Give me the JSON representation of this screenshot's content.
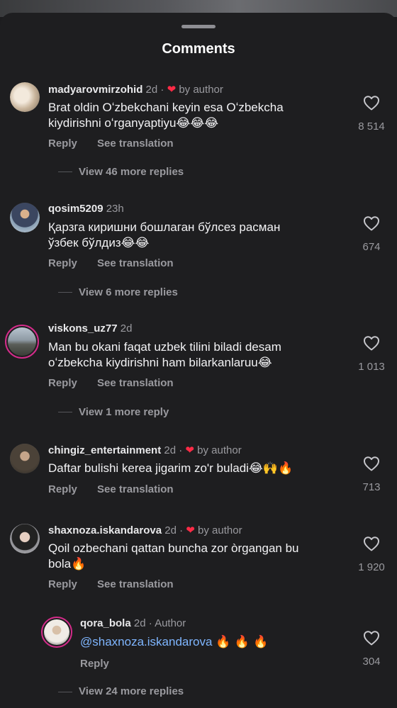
{
  "sheet": {
    "title": "Comments"
  },
  "comments": [
    {
      "username": "madyarovmirzohid",
      "time": "2d",
      "liked_by_author": true,
      "badge": "by author",
      "line1": "Brat oldin Oʻzbekchani keyin esa Oʻzbekcha",
      "line2": "kiydirishni oʻrganyaptiyu",
      "emoji2": "😂😂😂",
      "likes": "8 514",
      "reply": "Reply",
      "translate": "See translation",
      "more": "View 46 more replies"
    },
    {
      "username": "qosim5209",
      "time": "23h",
      "line1": "Қарзга киришни бошлаган бўлсез расман",
      "line2": "ўзбек бўлдиз",
      "emoji2": "😂😂",
      "likes": "674",
      "reply": "Reply",
      "translate": "See translation",
      "more": "View 6 more replies"
    },
    {
      "username": "viskons_uz77",
      "time": "2d",
      "line1": "Man bu okani faqat uzbek tilini biladi desam",
      "line2": "oʻzbekcha kiydirishni ham bilarkanlaruu",
      "emoji2": "😂",
      "likes": "1 013",
      "reply": "Reply",
      "translate": "See translation",
      "more": "View 1 more reply"
    },
    {
      "username": "chingiz_entertainment",
      "time": "2d",
      "liked_by_author": true,
      "badge": "by author",
      "line1": "Daftar bulishi kerea jigarim zo'r buladi",
      "emoji1": "😂🙌🔥",
      "likes": "713",
      "reply": "Reply",
      "translate": "See translation"
    },
    {
      "username": "shaxnoza.iskandarova",
      "time": "2d",
      "liked_by_author": true,
      "badge": "by author",
      "line1": "Qoil ozbechani qattan buncha zor òrgangan bu",
      "line2": "bola",
      "emoji2": "🔥",
      "likes": "1 920",
      "reply": "Reply",
      "translate": "See translation"
    }
  ],
  "reply_item": {
    "username": "qora_bola",
    "time": "2d",
    "role": "Author",
    "mention": "@shaxnoza.iskandarova",
    "emoji": "🔥 🔥 🔥",
    "likes": "304",
    "reply": "Reply"
  },
  "bottom_more": "View 24 more replies",
  "colors": {
    "accent_heart": "#ff2b46",
    "mention": "#7fb6ff",
    "story_ring": "#d42c8a"
  },
  "icons": {
    "like": "heart-outline-icon",
    "author_like": "heart-filled-icon"
  }
}
